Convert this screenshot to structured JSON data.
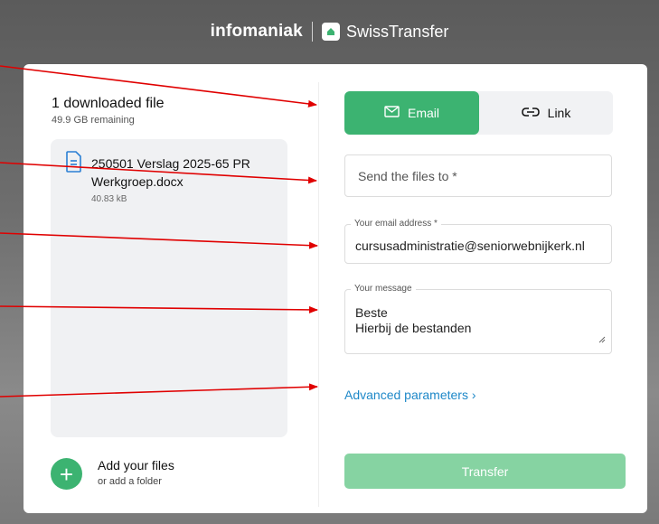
{
  "header": {
    "brand": "infomaniak",
    "product": "SwissTransfer"
  },
  "left": {
    "title": "1 downloaded file",
    "remaining": "49.9 GB remaining",
    "file": {
      "name": "250501 Verslag 2025-65 PR Werkgroep.docx",
      "size": "40.83 kB",
      "icon": "document-icon"
    },
    "add_files_label": "Add your files",
    "add_folder_label": "or add a folder"
  },
  "right": {
    "tabs": {
      "email_label": "Email",
      "link_label": "Link"
    },
    "recipient_placeholder": "Send the files to *",
    "email_label": "Your email address *",
    "email_value": "cursusadministratie@seniorwebnijkerk.nl",
    "message_label": "Your message",
    "message_line1": "Beste",
    "message_line2": "Hierbij de bestanden",
    "advanced_label": "Advanced parameters",
    "transfer_label": "Transfer"
  },
  "colors": {
    "accent": "#3cb371",
    "accent_disabled": "#86d3a2",
    "link": "#1e88c8",
    "annotation_arrow": "#e00000"
  }
}
